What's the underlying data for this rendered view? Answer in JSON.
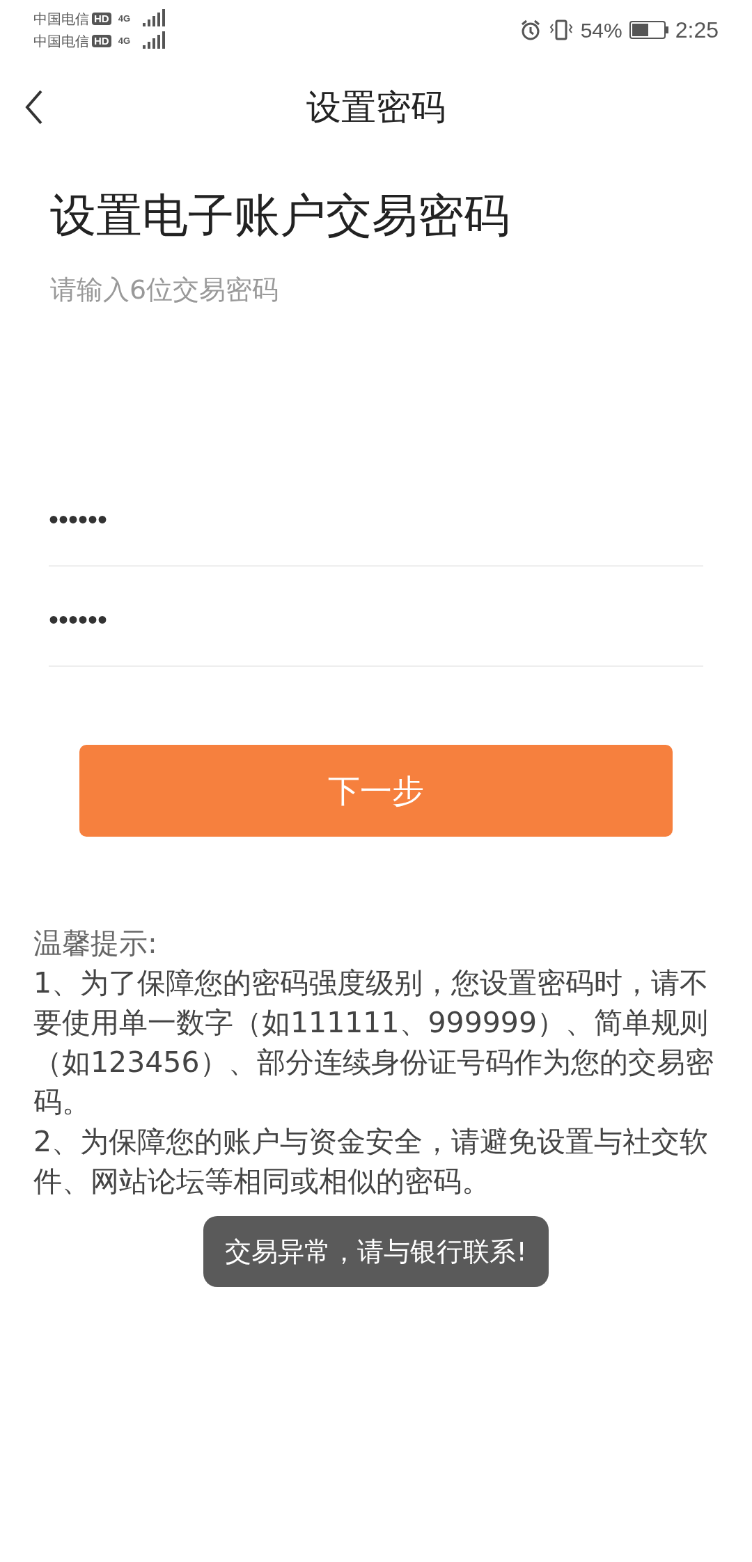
{
  "status_bar": {
    "carriers": [
      {
        "name": "中国电信",
        "badge": "HD",
        "network": "4G"
      },
      {
        "name": "中国电信",
        "badge": "HD",
        "network": "4G"
      }
    ],
    "battery_text": "54%",
    "battery": {
      "level": 0.54
    },
    "time": "2:25"
  },
  "header": {
    "title": "设置密码"
  },
  "heading": "设置电子账户交易密码",
  "subtitle": "请输入6位交易密码",
  "fields": [
    {
      "value": "••••••"
    },
    {
      "value": "••••••"
    }
  ],
  "next_button": "下一步",
  "tips": {
    "title": "温馨提示:",
    "items": [
      "1、为了保障您的密码强度级别，您设置密码时，请不要使用单一数字（如111111、999999）、简单规则（如123456）、部分连续身份证号码作为您的交易密码。",
      "2、为保障您的账户与资金安全，请避免设置与社交软件、网站论坛等相同或相似的密码。"
    ]
  },
  "toast": "交易异常，请与银行联系!"
}
